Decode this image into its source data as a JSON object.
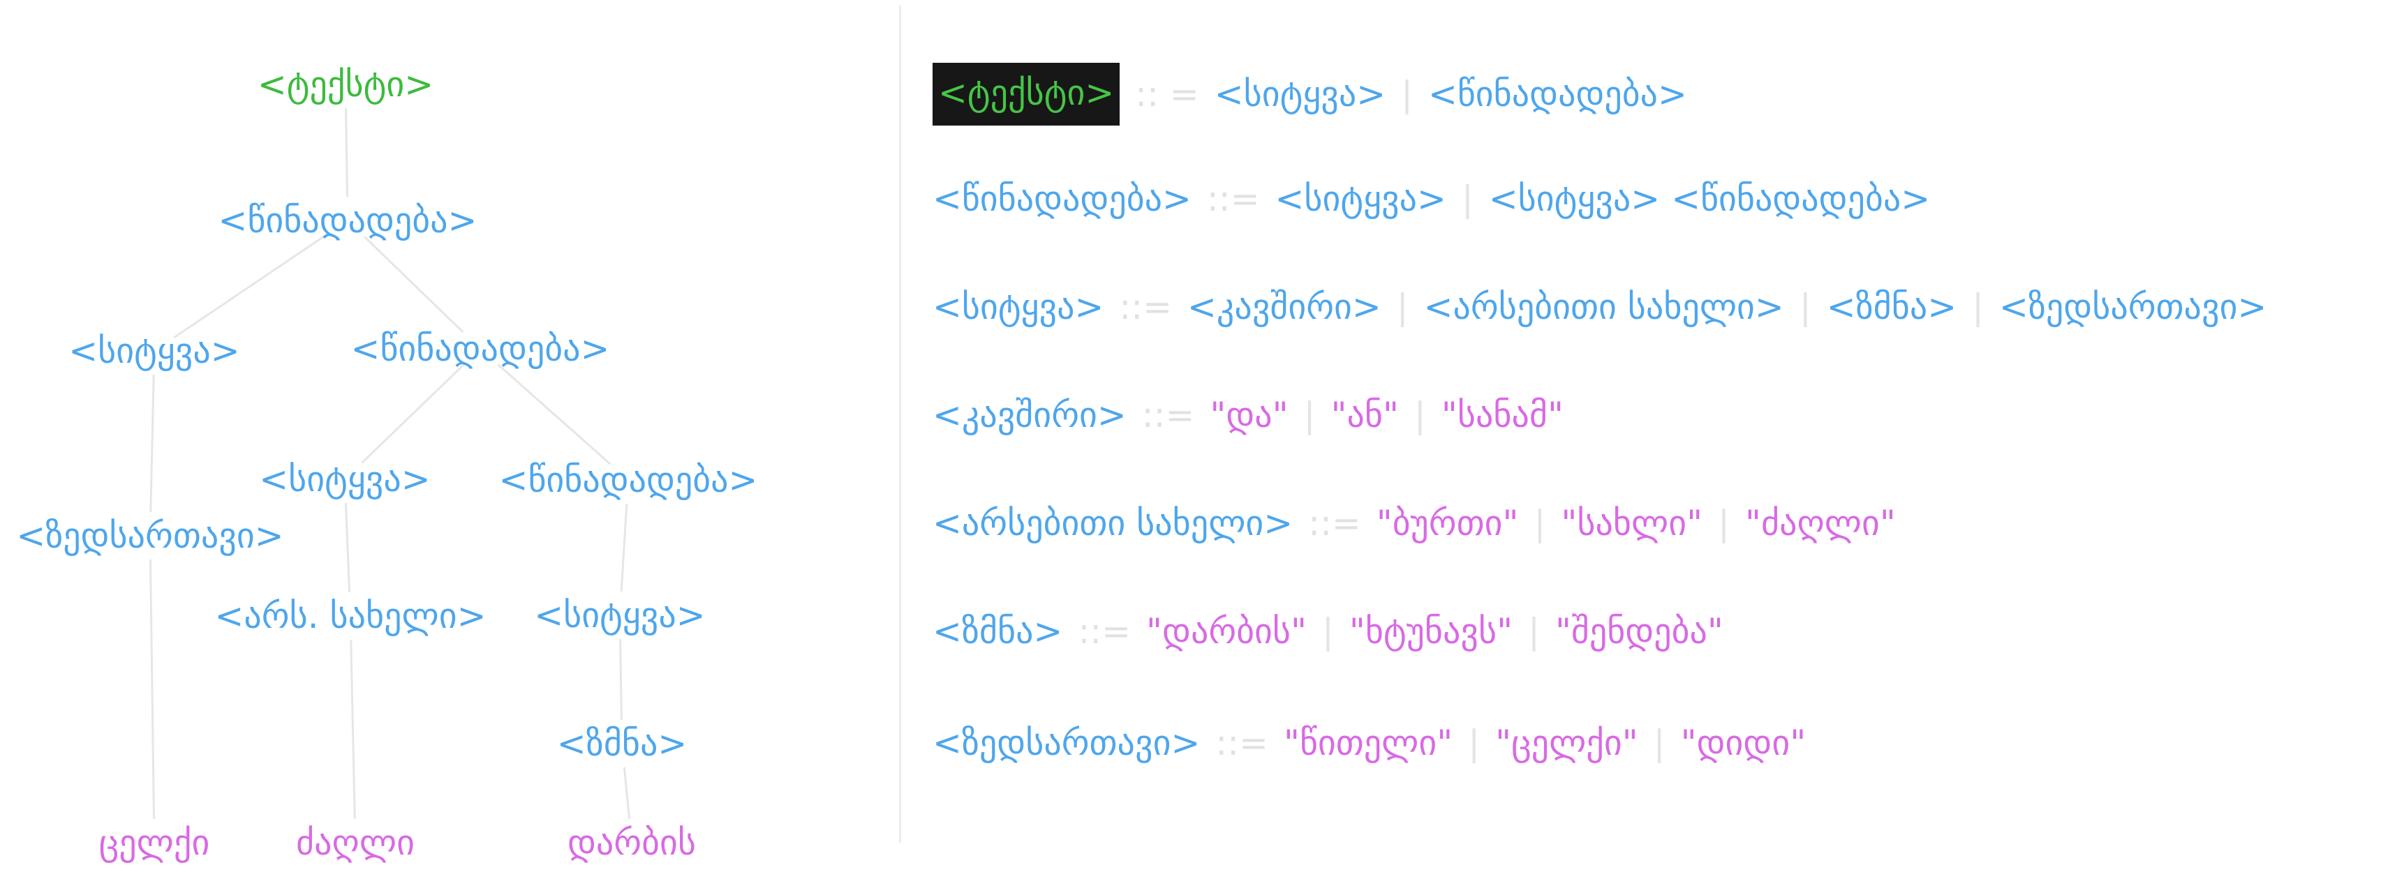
{
  "tree": {
    "nodes": [
      {
        "id": "root",
        "label": "<ტექსტი>",
        "kind": "root"
      },
      {
        "id": "s1",
        "label": "<წინადადება>",
        "kind": "nt"
      },
      {
        "id": "w1",
        "label": "<სიტყვა>",
        "kind": "nt"
      },
      {
        "id": "s2",
        "label": "<წინადადება>",
        "kind": "nt"
      },
      {
        "id": "adj",
        "label": "<ზედსართავი>",
        "kind": "nt"
      },
      {
        "id": "w2",
        "label": "<სიტყვა>",
        "kind": "nt"
      },
      {
        "id": "s3",
        "label": "<წინადადება>",
        "kind": "nt"
      },
      {
        "id": "noun",
        "label": "<არს. სახელი>",
        "kind": "nt"
      },
      {
        "id": "w3",
        "label": "<სიტყვა>",
        "kind": "nt"
      },
      {
        "id": "verb",
        "label": "<ზმნა>",
        "kind": "nt"
      },
      {
        "id": "l1",
        "label": "ცელქი",
        "kind": "leaf"
      },
      {
        "id": "l2",
        "label": "ძაღლი",
        "kind": "leaf"
      },
      {
        "id": "l3",
        "label": "დარბის",
        "kind": "leaf"
      }
    ],
    "edges": [
      [
        "root",
        "s1"
      ],
      [
        "s1",
        "w1"
      ],
      [
        "s1",
        "s2"
      ],
      [
        "w1",
        "adj"
      ],
      [
        "adj",
        "l1"
      ],
      [
        "s2",
        "w2"
      ],
      [
        "s2",
        "s3"
      ],
      [
        "w2",
        "noun"
      ],
      [
        "noun",
        "l2"
      ],
      [
        "s3",
        "w3"
      ],
      [
        "w3",
        "verb"
      ],
      [
        "verb",
        "l3"
      ]
    ]
  },
  "grammar": {
    "rules": [
      {
        "lhs": "<ტექსტი>",
        "op": ":: =",
        "highlight": true,
        "alts": [
          [
            {
              "t": "<სიტყვა>",
              "k": "nt"
            }
          ],
          [
            {
              "t": "<წინადადება>",
              "k": "nt"
            }
          ]
        ]
      },
      {
        "lhs": "<წინადადება>",
        "op": "::=",
        "alts": [
          [
            {
              "t": "<სიტყვა>",
              "k": "nt"
            }
          ],
          [
            {
              "t": "<სიტყვა>",
              "k": "nt"
            },
            {
              "t": "<წინადადება>",
              "k": "nt"
            }
          ]
        ]
      },
      {
        "lhs": "<სიტყვა>",
        "op": "::=",
        "alts": [
          [
            {
              "t": "<კავშირი>",
              "k": "nt"
            }
          ],
          [
            {
              "t": "<არსებითი სახელი>",
              "k": "nt"
            }
          ],
          [
            {
              "t": "<ზმნა>",
              "k": "nt"
            }
          ],
          [
            {
              "t": "<ზედსართავი>",
              "k": "nt"
            }
          ]
        ]
      },
      {
        "lhs": "<კავშირი>",
        "op": "::=",
        "alts": [
          [
            {
              "t": "\"და\"",
              "k": "lit"
            }
          ],
          [
            {
              "t": "\"ან\"",
              "k": "lit"
            }
          ],
          [
            {
              "t": "\"სანამ\"",
              "k": "lit"
            }
          ]
        ]
      },
      {
        "lhs": "<არსებითი სახელი>",
        "op": "::=",
        "alts": [
          [
            {
              "t": "\"ბურთი\"",
              "k": "lit"
            }
          ],
          [
            {
              "t": "\"სახლი\"",
              "k": "lit"
            }
          ],
          [
            {
              "t": "\"ძაღლი\"",
              "k": "lit"
            }
          ]
        ]
      },
      {
        "lhs": "<ზმნა>",
        "op": "::=",
        "alts": [
          [
            {
              "t": "\"დარბის\"",
              "k": "lit"
            }
          ],
          [
            {
              "t": "\"ხტუნავს\"",
              "k": "lit"
            }
          ],
          [
            {
              "t": "\"შენდება\"",
              "k": "lit"
            }
          ]
        ]
      },
      {
        "lhs": "<ზედსართავი>",
        "op": "::=",
        "alts": [
          [
            {
              "t": "\"წითელი\"",
              "k": "lit"
            }
          ],
          [
            {
              "t": "\"ცელქი\"",
              "k": "lit"
            }
          ],
          [
            {
              "t": "\"დიდი\"",
              "k": "lit"
            }
          ]
        ]
      }
    ]
  },
  "colors": {
    "nonterminal": "#4ea6ec",
    "terminal": "#d86ae4",
    "root": "#3cbb3c",
    "edge": "#e6e6e6",
    "highlight_bg": "#171717"
  }
}
